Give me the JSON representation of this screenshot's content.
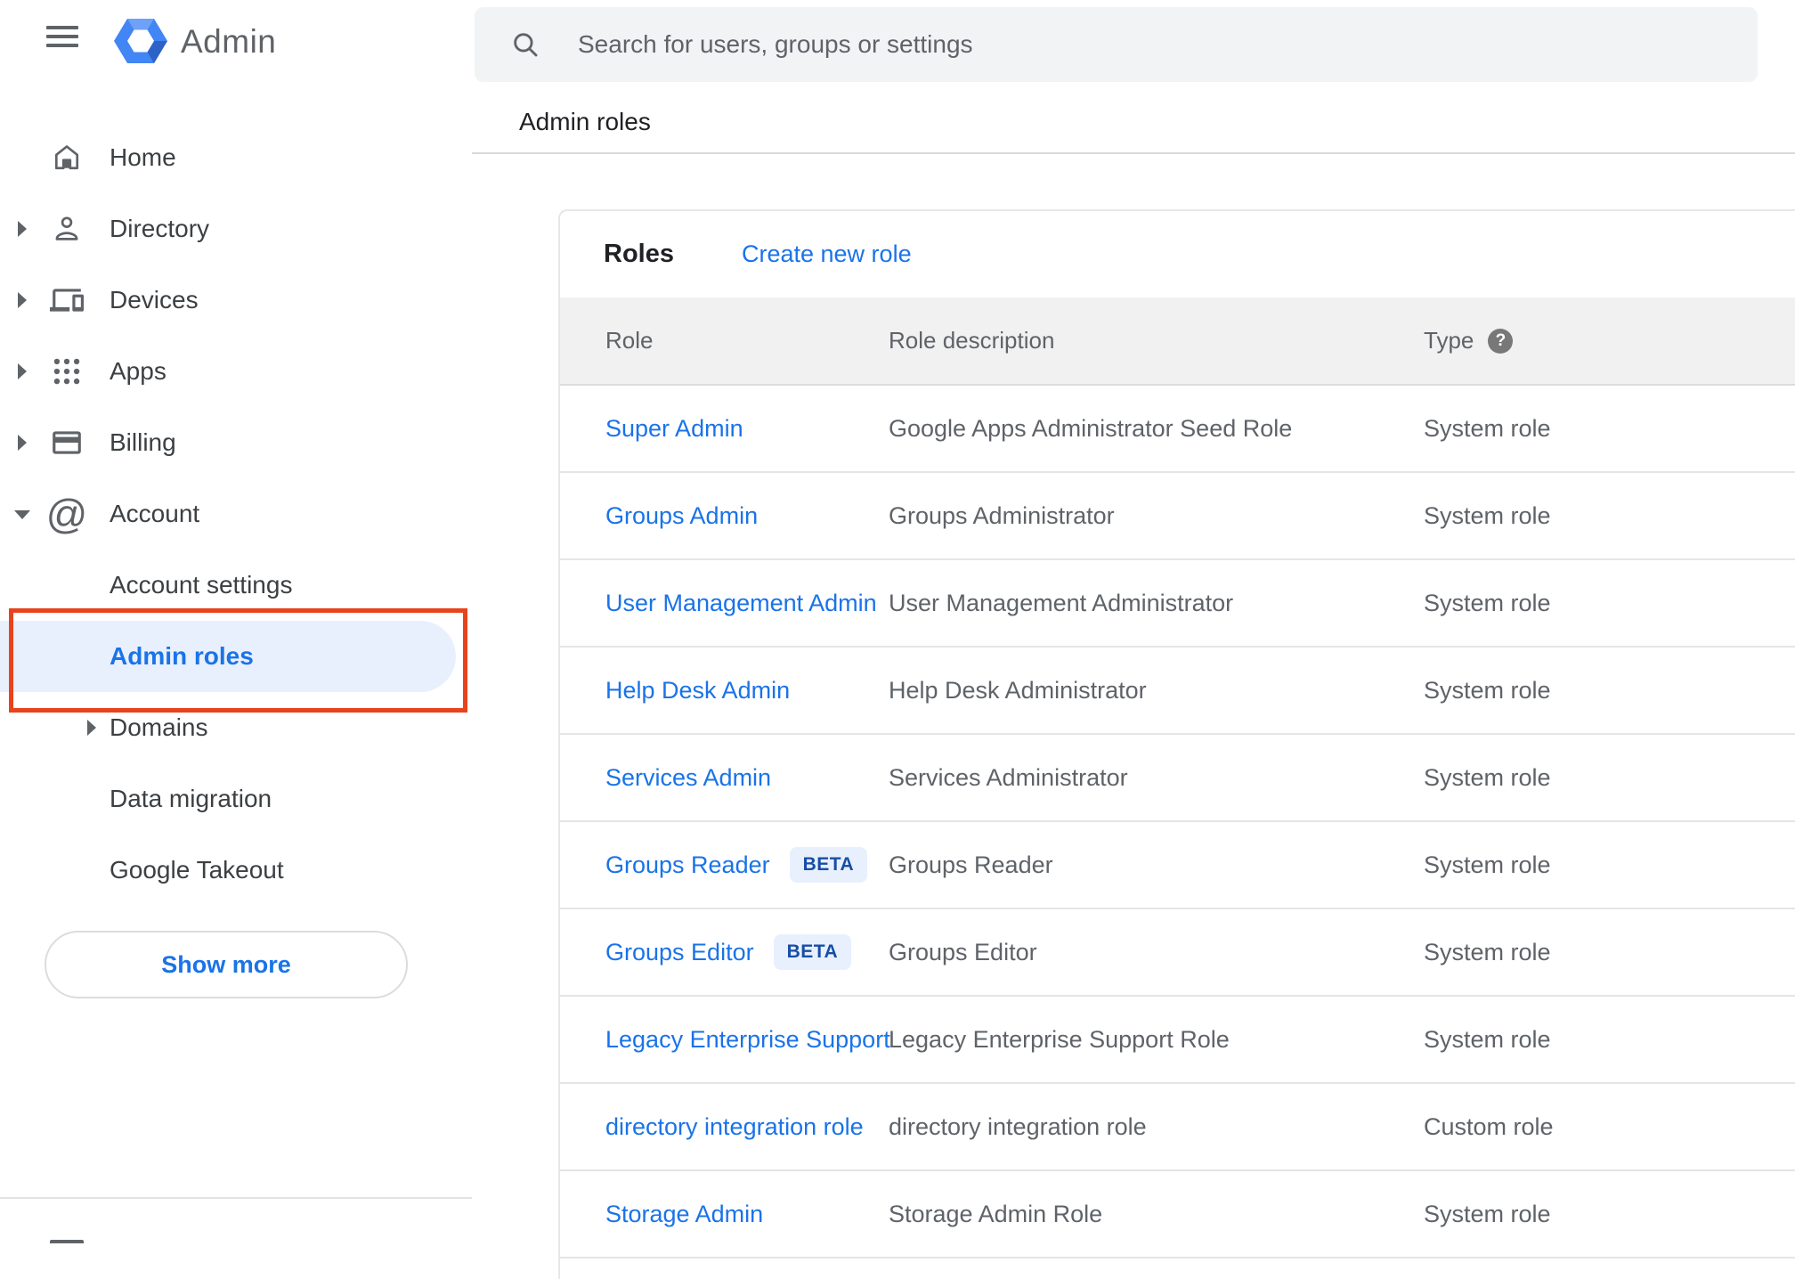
{
  "brand": {
    "app_name": "Admin"
  },
  "search": {
    "placeholder": "Search for users, groups or settings"
  },
  "breadcrumb": "Admin roles",
  "colors": {
    "accent_blue": "#1a73e8",
    "selected_item_bg": "#e8f0fe",
    "annotation_red": "#e8431c",
    "beta_text": "#174ea6",
    "table_header_bg": "#f1f1f1",
    "text_gray": "#5f6368"
  },
  "sidebar": {
    "items": [
      {
        "label": "Home"
      },
      {
        "label": "Directory"
      },
      {
        "label": "Devices"
      },
      {
        "label": "Apps"
      },
      {
        "label": "Billing"
      },
      {
        "label": "Account"
      }
    ],
    "children": [
      {
        "label": "Account settings"
      },
      {
        "label": "Admin roles"
      },
      {
        "label": "Domains"
      },
      {
        "label": "Data migration"
      },
      {
        "label": "Google Takeout"
      }
    ],
    "show_more_label": "Show more"
  },
  "roles_panel": {
    "title": "Roles",
    "create_link": "Create new role",
    "beta_badge_label": "BETA",
    "columns": {
      "role": "Role",
      "description": "Role description",
      "type": "Type"
    },
    "rows": [
      {
        "role": "Super Admin",
        "description": "Google Apps Administrator Seed Role",
        "type": "System role"
      },
      {
        "role": "Groups Admin",
        "description": "Groups Administrator",
        "type": "System role"
      },
      {
        "role": "User Management Admin",
        "description": "User Management Administrator",
        "type": "System role"
      },
      {
        "role": "Help Desk Admin",
        "description": "Help Desk Administrator",
        "type": "System role"
      },
      {
        "role": "Services Admin",
        "description": "Services Administrator",
        "type": "System role"
      },
      {
        "role": "Groups Reader",
        "description": "Groups Reader",
        "type": "System role"
      },
      {
        "role": "Groups Editor",
        "description": "Groups Editor",
        "type": "System role"
      },
      {
        "role": "Legacy Enterprise Support",
        "description": "Legacy Enterprise Support Role",
        "type": "System role"
      },
      {
        "role": "directory integration role",
        "description": "directory integration role",
        "type": "Custom role"
      },
      {
        "role": "Storage Admin",
        "description": "Storage Admin Role",
        "type": "System role"
      }
    ]
  }
}
